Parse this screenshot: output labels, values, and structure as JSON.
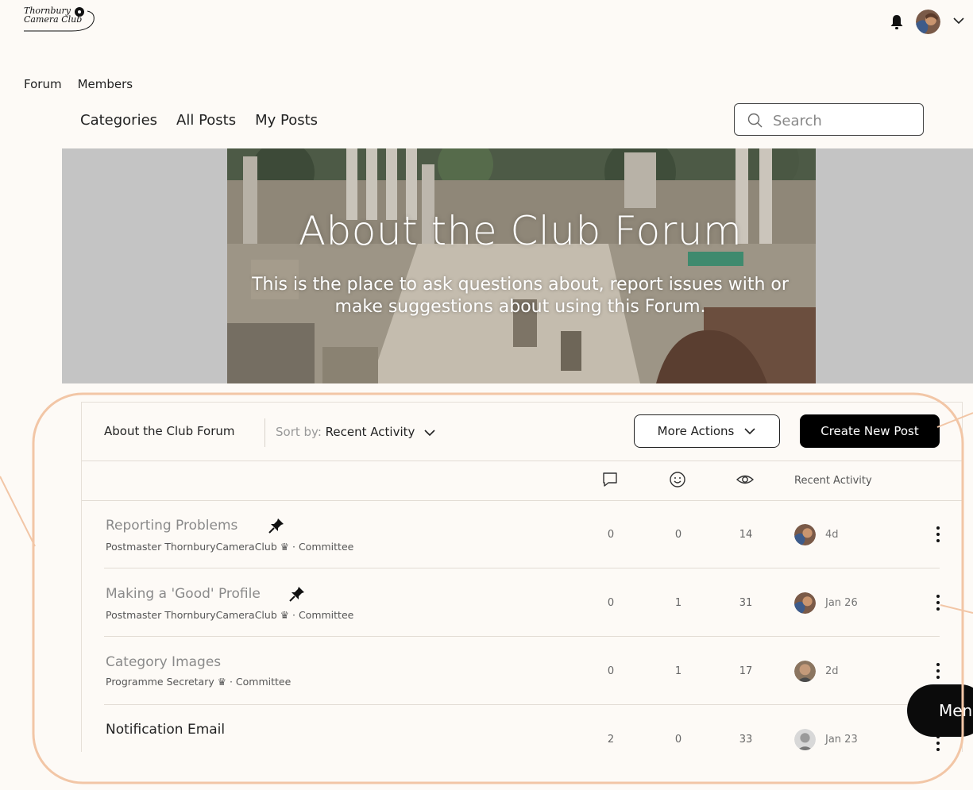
{
  "logo": {
    "line1": "Thornbury",
    "line2": "Camera Club"
  },
  "site_nav": {
    "items": [
      "Forum",
      "Members"
    ]
  },
  "forum_nav": {
    "items": [
      "Categories",
      "All Posts",
      "My Posts"
    ]
  },
  "search": {
    "placeholder": "Search"
  },
  "hero": {
    "title": "About the Club Forum",
    "subtitle_line1": "This is the place to ask questions about, report issues with or",
    "subtitle_line2": "make suggestions about using this Forum."
  },
  "toolbar": {
    "category": "About the Club Forum",
    "sort_prefix": "Sort by:",
    "sort_value": "Recent Activity",
    "more_actions": "More Actions",
    "create_post": "Create New Post"
  },
  "columns": {
    "recent_activity": "Recent Activity"
  },
  "posts": [
    {
      "title": "Reporting Problems",
      "pinned": true,
      "author": "Postmaster ThornburyCameraClub",
      "role": "Committee",
      "comments": "0",
      "likes": "0",
      "views": "14",
      "time": "4d"
    },
    {
      "title": "Making a 'Good' Profile",
      "pinned": true,
      "author": "Postmaster ThornburyCameraClub",
      "role": "Committee",
      "comments": "0",
      "likes": "1",
      "views": "31",
      "time": "Jan 26"
    },
    {
      "title": "Category Images",
      "pinned": false,
      "author": "Programme Secretary",
      "role": "Committee",
      "comments": "0",
      "likes": "1",
      "views": "17",
      "time": "2d"
    },
    {
      "title": "Notification Email",
      "pinned": false,
      "author": "",
      "role": "",
      "comments": "2",
      "likes": "0",
      "views": "33",
      "time": "Jan 23"
    }
  ],
  "chat_button": {
    "label": "Men"
  },
  "colors": {
    "annotation": "#f2c6a6",
    "primary_button": "#000000",
    "hero_band": "#c4c4c4"
  }
}
